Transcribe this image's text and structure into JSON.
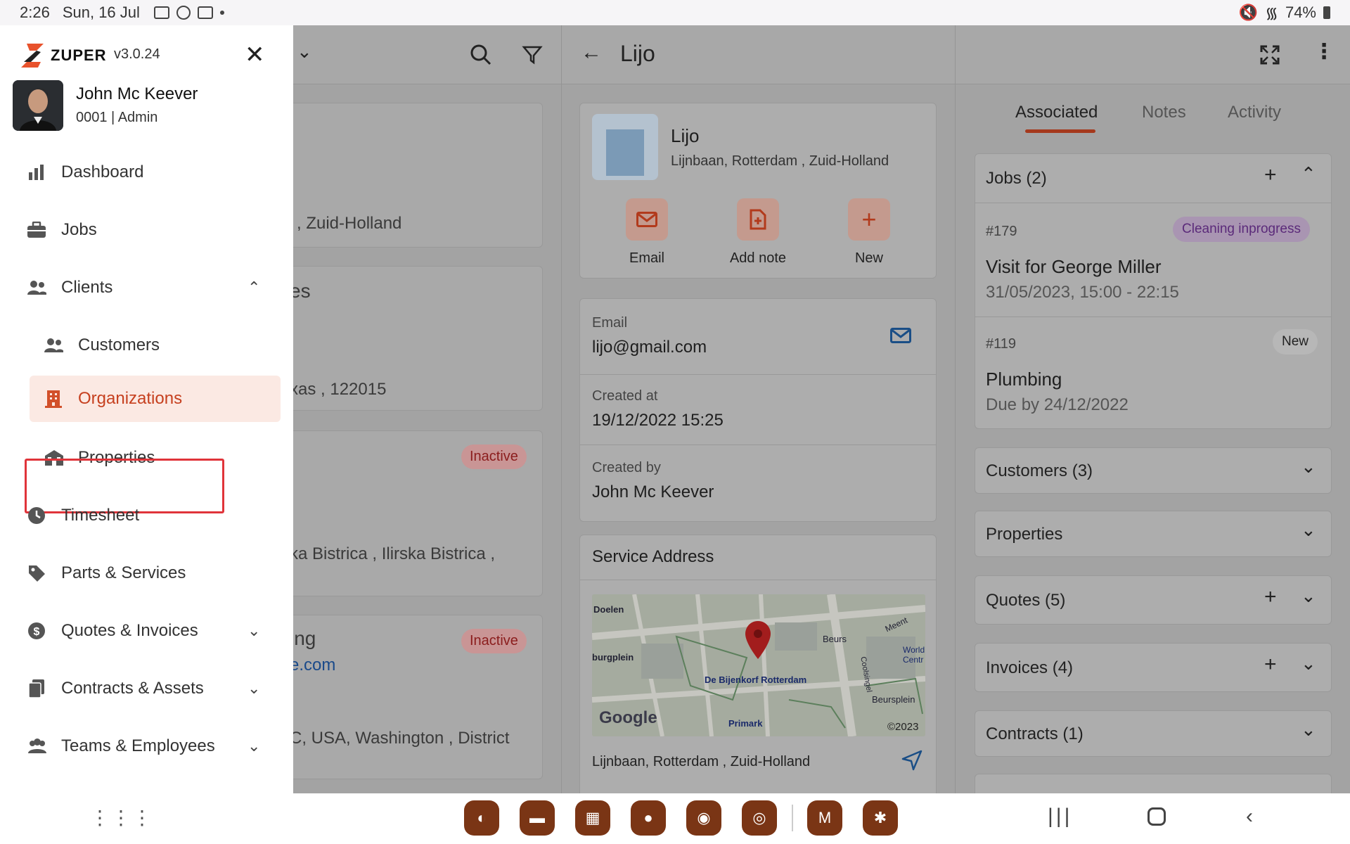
{
  "status_bar": {
    "time": "2:26",
    "date": "Sun, 16 Jul",
    "battery": "74%"
  },
  "drawer": {
    "brand": "ZUPER",
    "version": "v3.0.24",
    "user": {
      "name": "John Mc Keever",
      "role": "0001 | Admin"
    },
    "items": [
      {
        "label": "Dashboard"
      },
      {
        "label": "Jobs"
      },
      {
        "label": "Clients"
      },
      {
        "label": "Customers"
      },
      {
        "label": "Organizations"
      },
      {
        "label": "Properties"
      },
      {
        "label": "Timesheet"
      },
      {
        "label": "Parts & Services"
      },
      {
        "label": "Quotes & Invoices"
      },
      {
        "label": "Contracts & Assets"
      },
      {
        "label": "Teams & Employees"
      }
    ]
  },
  "list_panel": {
    "rows": [
      {
        "text": ", Zuid-Holland"
      },
      {
        "text": "es"
      },
      {
        "text": "xas , 122015"
      },
      {
        "text": "ka Bistrica , Ilirska Bistrica ,"
      },
      {
        "text": "ing"
      },
      {
        "text": "e.com"
      },
      {
        "text": "C, USA, Washington , District"
      }
    ],
    "inactive_label": "Inactive"
  },
  "detail": {
    "title": "Lijo",
    "org": {
      "name": "Lijo",
      "address": "Lijnbaan, Rotterdam , Zuid-Holland"
    },
    "actions": {
      "email": "Email",
      "add_note": "Add note",
      "new": "New"
    },
    "fields": {
      "email_label": "Email",
      "email_value": "lijo@gmail.com",
      "created_at_label": "Created at",
      "created_at_value": "19/12/2022 15:25",
      "created_by_label": "Created by",
      "created_by_value": "John Mc Keever"
    },
    "service_address": {
      "title": "Service Address",
      "address": "Lijnbaan, Rotterdam , Zuid-Holland",
      "map_labels": {
        "doelen": "Doelen",
        "burgplein": "burgplein",
        "beurs": "Beurs",
        "bijenkorf": "De Bijenkorf Rotterdam",
        "primark": "Primark",
        "beursplein": "Beursplein",
        "coolsingel": "Coolsingel",
        "meent": "Meent",
        "world": "World",
        "centre": "Centr",
        "google": "Google",
        "copyright": "©2023"
      }
    }
  },
  "right_panel": {
    "tabs": {
      "associated": "Associated",
      "notes": "Notes",
      "activity": "Activity"
    },
    "jobs": {
      "title": "Jobs (2)",
      "items": [
        {
          "number": "#179",
          "status": "Cleaning inprogress",
          "title": "Visit for George Miller",
          "time": "31/05/2023, 15:00 - 22:15"
        },
        {
          "number": "#119",
          "status": "New",
          "title": "Plumbing",
          "time": "Due by 24/12/2022"
        }
      ]
    },
    "sections": {
      "customers": "Customers (3)",
      "properties": "Properties",
      "quotes": "Quotes (5)",
      "invoices": "Invoices (4)",
      "contracts": "Contracts (1)"
    }
  },
  "colors": {
    "accent": "#d2502a",
    "active_bg": "#fbe9e3",
    "highlight": "#e0343a"
  }
}
